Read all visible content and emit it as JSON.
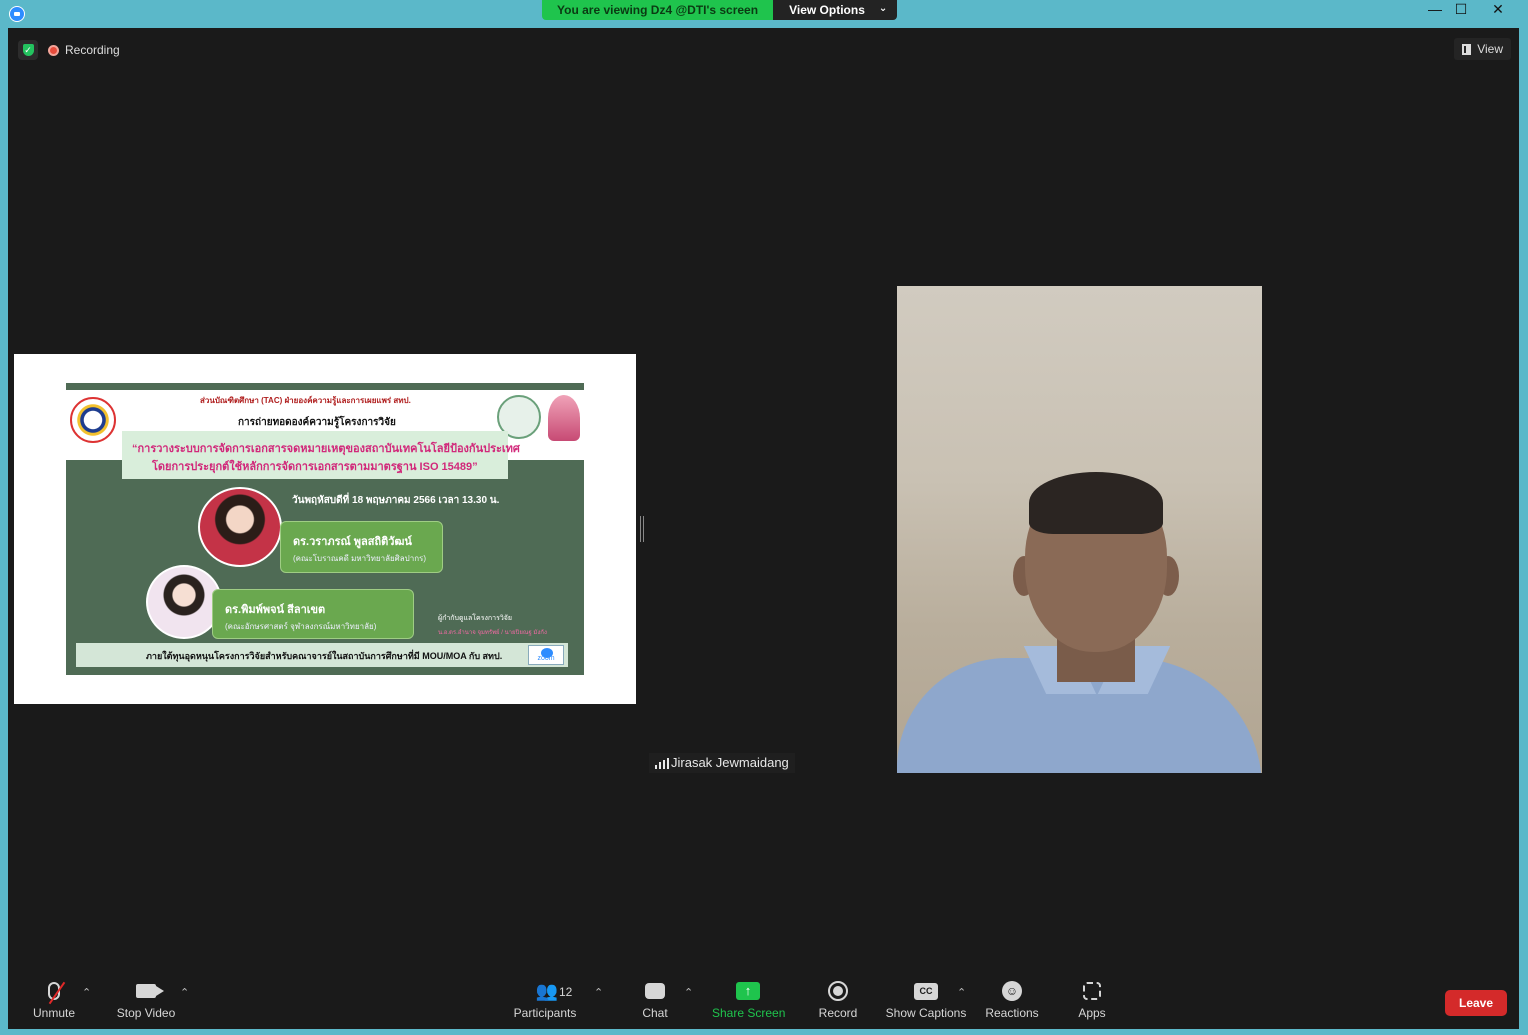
{
  "window": {
    "banner_text": "You are viewing Dz4 @DTI's screen",
    "view_options_label": "View Options",
    "minimize_glyph": "—",
    "maximize_glyph": "☐",
    "close_glyph": "✕"
  },
  "meeting": {
    "recording_label": "Recording",
    "view_label": "View",
    "active_speaker_name": "Jirasak Jewmaidang"
  },
  "shared_screen": {
    "org_line": "ส่วนบัณฑิตศึกษา (TAC) ฝ่ายองค์ความรู้และการเผยแพร่ สทป.",
    "subtitle": "การถ่ายทอดองค์ความรู้โครงการวิจัย",
    "title_line1": "“การวางระบบการจัดการเอกสารจดหมายเหตุของสถาบันเทคโนโลยีป้องกันประเทศ",
    "title_line2": "โดยการประยุกต์ใช้หลักการจัดการเอกสารตามมาตรฐาน ISO 15489”",
    "date_line": "วันพฤหัสบดีที่ 18 พฤษภาคม 2566 เวลา 13.30 น.",
    "speakers": [
      {
        "name": "ดร.วราภรณ์ พูลสถิติวัฒน์",
        "affiliation": "(คณะโบราณคดี มหาวิทยาลัยศิลปากร)"
      },
      {
        "name": "ดร.พิมพ์พจน์ สีลาเขต",
        "affiliation": "(คณะอักษรศาสตร์ จุฬาลงกรณ์มหาวิทยาลัย)"
      }
    ],
    "host_label": "ผู้กำกับดูแลโครงการวิจัย",
    "host_names": "น.อ.ดร.อำนาจ จุมทรัพย์ / นายปิยณฐ มังกัง",
    "footer_text": "ภายใต้ทุนอุดหนุนโครงการวิจัยสำหรับคณาจารย์ในสถาบันการศึกษาที่มี MOU/MOA กับ สทป.",
    "zoom_logo_text": "zoom"
  },
  "toolbar": {
    "unmute": "Unmute",
    "stop_video": "Stop Video",
    "participants": "Participants",
    "participants_count": "12",
    "chat": "Chat",
    "share_screen": "Share Screen",
    "record": "Record",
    "show_captions": "Show Captions",
    "captions_icon_text": "CC",
    "reactions": "Reactions",
    "apps": "Apps",
    "leave": "Leave",
    "share_icon_glyph": "↑",
    "reaction_icon_glyph": "☺",
    "caret_glyph": "⌃"
  },
  "colors": {
    "titlebar": "#5bb8c9",
    "banner_green": "#1fc44d",
    "meeting_bg": "#1a1a1a",
    "leave_red": "#d42a2a",
    "poster_green": "#4f6b55"
  }
}
